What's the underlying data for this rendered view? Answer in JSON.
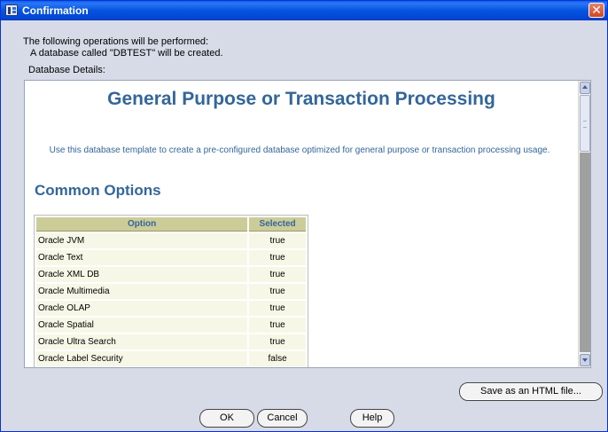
{
  "window": {
    "title": "Confirmation",
    "close_symbol": "✕"
  },
  "summary": {
    "header": "The following operations will be performed:",
    "operation": "A database called \"DBTEST\" will be created.",
    "details_label": "Database Details:"
  },
  "template": {
    "title": "General Purpose or Transaction Processing",
    "description": "Use this database template to create a pre-configured database optimized for general purpose or transaction processing usage."
  },
  "common_options": {
    "section_title": "Common Options",
    "columns": [
      "Option",
      "Selected"
    ],
    "rows": [
      {
        "option": "Oracle JVM",
        "selected": "true"
      },
      {
        "option": "Oracle Text",
        "selected": "true"
      },
      {
        "option": "Oracle XML DB",
        "selected": "true"
      },
      {
        "option": "Oracle Multimedia",
        "selected": "true"
      },
      {
        "option": "Oracle OLAP",
        "selected": "true"
      },
      {
        "option": "Oracle Spatial",
        "selected": "true"
      },
      {
        "option": "Oracle Ultra Search",
        "selected": "true"
      },
      {
        "option": "Oracle Label Security",
        "selected": "false"
      }
    ]
  },
  "buttons": {
    "save_html": "Save as an HTML file...",
    "ok": "OK",
    "cancel": "Cancel",
    "help": "Help"
  },
  "icons": {
    "window_icon": "database-window-icon",
    "close": "close-icon",
    "scroll_up": "scroll-up-arrow-icon",
    "scroll_down": "scroll-down-arrow-icon"
  },
  "colors": {
    "titlebar": "#0454e0",
    "heading": "#336699",
    "table_header": "#cccc99",
    "table_cell": "#f7f7e7",
    "dialog_bg": "#d6dbe7"
  }
}
